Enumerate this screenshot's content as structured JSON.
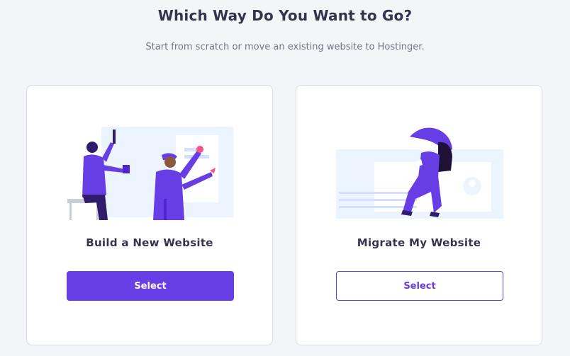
{
  "header": {
    "title": "Which Way Do You Want to Go?",
    "subtitle": "Start from scratch or move an existing website to Hostinger."
  },
  "options": [
    {
      "title": "Build a New Website",
      "button_label": "Select",
      "illustration": "builders-illustration"
    },
    {
      "title": "Migrate My Website",
      "button_label": "Select",
      "illustration": "migration-illustration"
    }
  ],
  "colors": {
    "accent": "#673de6",
    "purple_dark": "#2f1c6a",
    "illustration_bg": "#ebf4ff",
    "text": "#36344d",
    "muted": "#727586"
  }
}
